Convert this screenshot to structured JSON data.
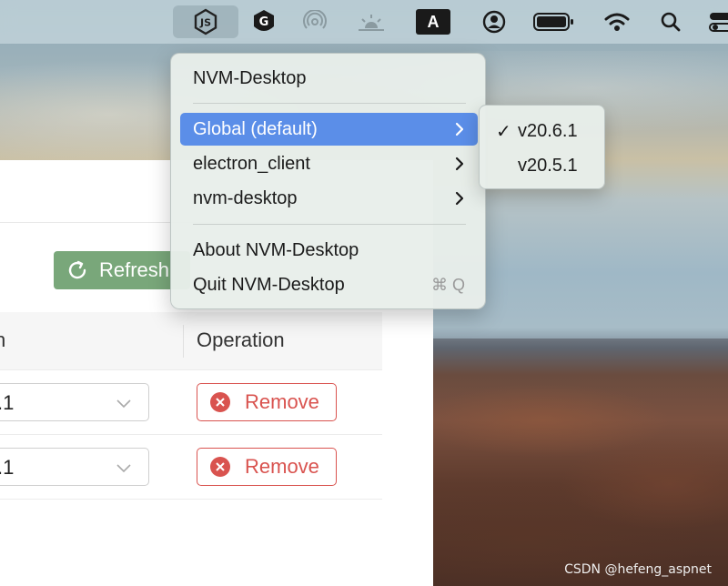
{
  "menubar": {
    "icons": [
      "nodejs-icon",
      "g-app-icon",
      "airdrop-icon",
      "brightness-icon",
      "input-source-icon",
      "user-icon",
      "battery-icon",
      "wifi-icon",
      "search-icon",
      "control-center-icon"
    ],
    "input_source_label": "A"
  },
  "app": {
    "refresh_label": "Refresh",
    "table": {
      "col_version_fragment": "n",
      "col_operation": "Operation",
      "rows": [
        {
          "version": ".1",
          "action": "Remove"
        },
        {
          "version": ".1",
          "action": "Remove"
        }
      ]
    }
  },
  "menu": {
    "title": "NVM-Desktop",
    "items": [
      {
        "label": "Global (default)",
        "has_submenu": true,
        "highlighted": true
      },
      {
        "label": "electron_client",
        "has_submenu": true
      },
      {
        "label": "nvm-desktop",
        "has_submenu": true
      }
    ],
    "about_label": "About NVM-Desktop",
    "quit_label": "Quit NVM-Desktop",
    "quit_shortcut": "⌘ Q"
  },
  "submenu": {
    "items": [
      {
        "label": "v20.6.1",
        "checked": true,
        "check_glyph": "✓"
      },
      {
        "label": "v20.5.1",
        "checked": false
      }
    ]
  },
  "watermark": "CSDN @hefeng_aspnet",
  "colors": {
    "accent": "#5b8ee8",
    "refresh_green": "#79a77a",
    "remove_red": "#d9534f"
  }
}
